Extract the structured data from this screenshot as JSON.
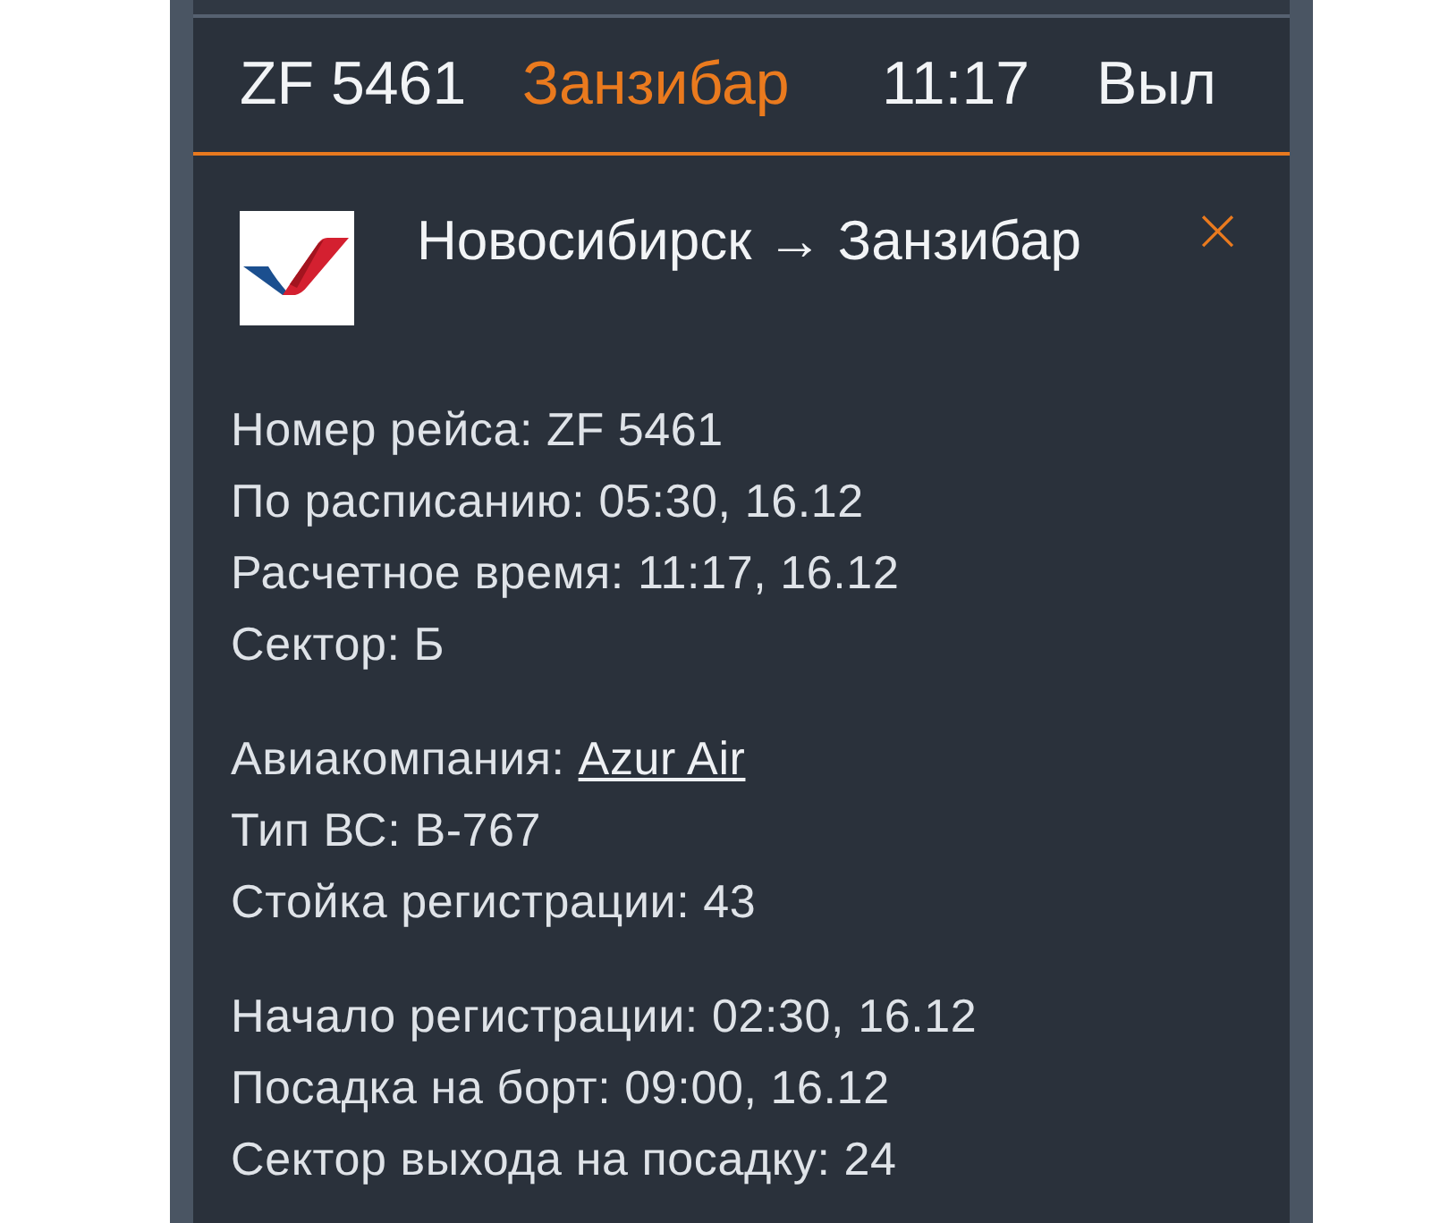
{
  "flight_row": {
    "number": "ZF 5461",
    "destination": "Занзибар",
    "time": "11:17",
    "status": "Выл"
  },
  "details": {
    "route": "Новосибирск → Занзибар",
    "close_label": "×",
    "groups": [
      [
        {
          "kind": "text",
          "label": "Номер рейса:",
          "value": "ZF 5461"
        },
        {
          "kind": "text",
          "label": "По расписанию:",
          "value": "05:30, 16.12"
        },
        {
          "kind": "text",
          "label": "Расчетное время:",
          "value": "11:17, 16.12"
        },
        {
          "kind": "text",
          "label": "Сектор:",
          "value": "Б"
        }
      ],
      [
        {
          "kind": "link",
          "label": "Авиакомпания:",
          "value": "Azur Air"
        },
        {
          "kind": "text",
          "label": "Тип ВС:",
          "value": "B-767"
        },
        {
          "kind": "text",
          "label": "Стойка регистрации:",
          "value": "43"
        }
      ],
      [
        {
          "kind": "text",
          "label": "Начало регистрации:",
          "value": "02:30, 16.12"
        },
        {
          "kind": "text",
          "label": "Посадка на борт:",
          "value": "09:00, 16.12"
        },
        {
          "kind": "text",
          "label": "Сектор выхода на посадку:",
          "value": "24"
        }
      ]
    ]
  }
}
